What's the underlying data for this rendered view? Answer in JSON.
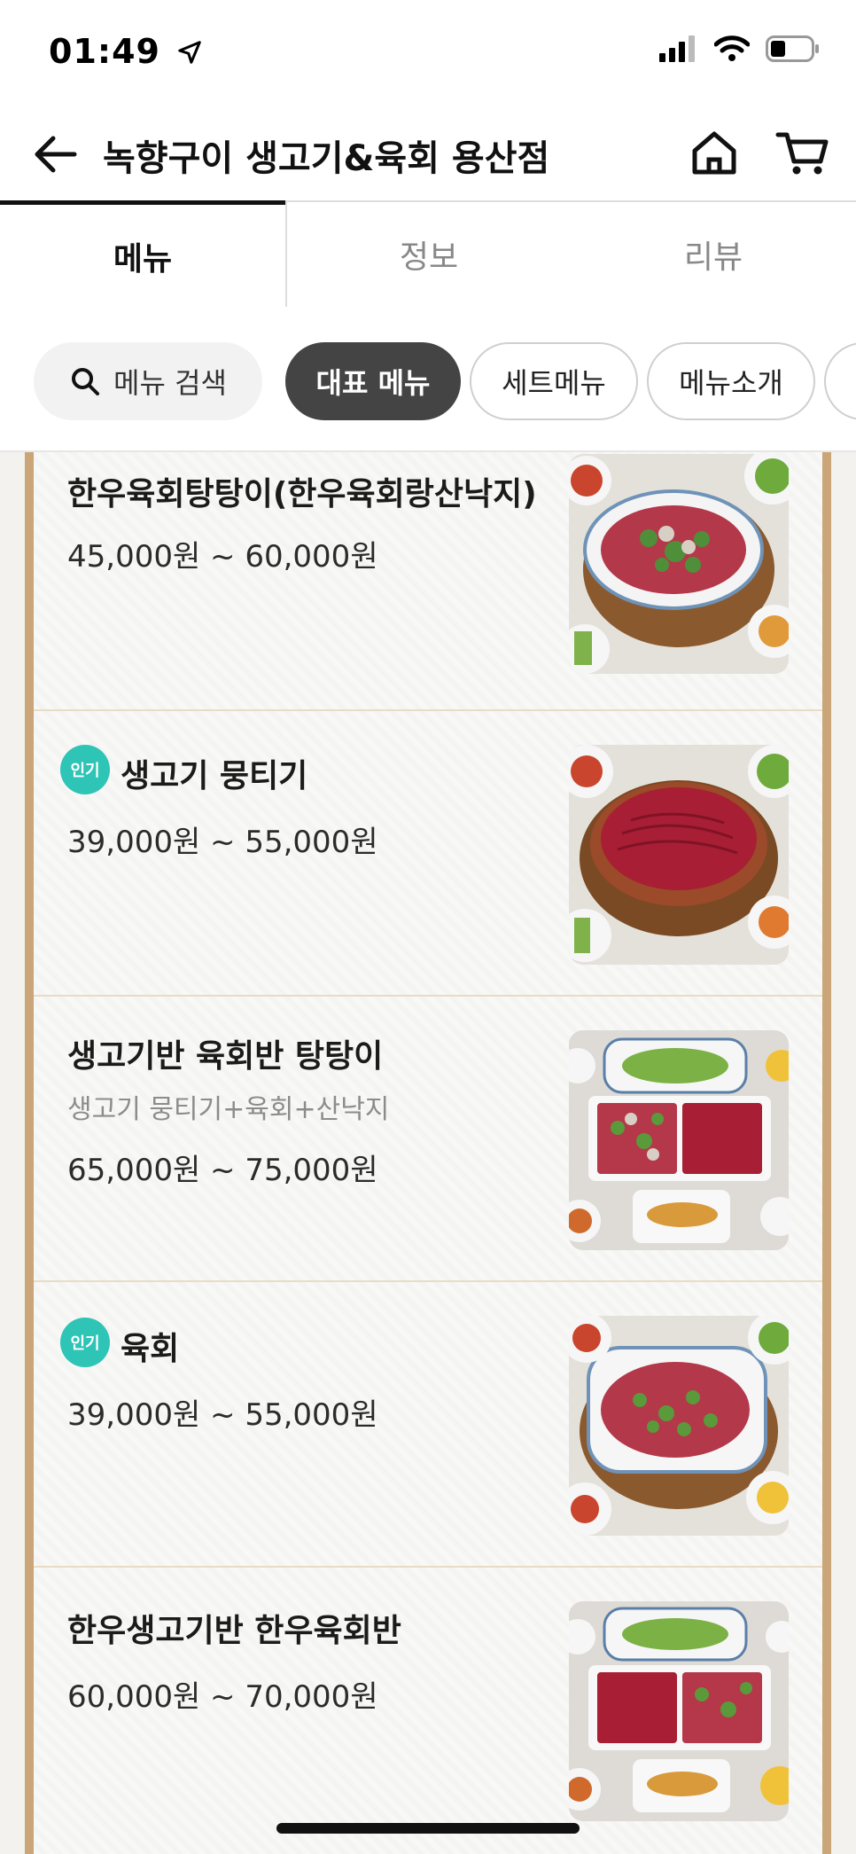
{
  "status": {
    "time": "01:49"
  },
  "header": {
    "title": "녹향구이 생고기&육회 용산점"
  },
  "tabs": [
    {
      "label": "메뉴"
    },
    {
      "label": "정보"
    },
    {
      "label": "리뷰"
    }
  ],
  "chips": {
    "search": "메뉴 검색",
    "items": [
      "대표 메뉴",
      "세트메뉴",
      "메뉴소개"
    ]
  },
  "menu": [
    {
      "name": "한우육회탕탕이(한우육회랑산낙지)",
      "badge": "",
      "desc": "",
      "price": "45,000원 ~ 60,000원"
    },
    {
      "name": "생고기 뭉티기",
      "badge": "인기",
      "desc": "",
      "price": "39,000원 ~ 55,000원"
    },
    {
      "name": "생고기반 육회반 탕탕이",
      "badge": "",
      "desc": "생고기 뭉티기+육회+산낙지",
      "price": "65,000원 ~ 75,000원"
    },
    {
      "name": "육회",
      "badge": "인기",
      "desc": "",
      "price": "39,000원 ~ 55,000원"
    },
    {
      "name": "한우생고기반   한우육회반",
      "badge": "",
      "desc": "",
      "price": "60,000원 ~ 70,000원"
    }
  ],
  "colors": {
    "accent": "#444444",
    "badge": "#2ec4b6",
    "frame": "#c9a577"
  }
}
